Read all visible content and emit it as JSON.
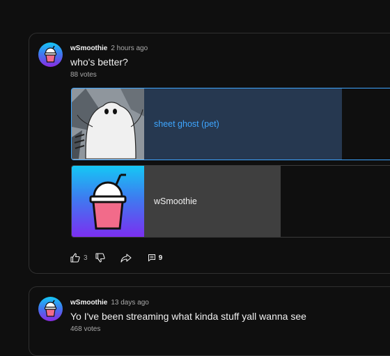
{
  "posts": [
    {
      "author": "wSmoothie",
      "time": "2 hours ago",
      "title": "who's better?",
      "votes": "88 votes",
      "options": [
        {
          "label": "sheet ghost (pet)",
          "percent": 80,
          "selected": true
        },
        {
          "label": "wSmoothie",
          "percent": 62,
          "selected": false
        }
      ],
      "likes": "3",
      "comments": "9"
    },
    {
      "author": "wSmoothie",
      "time": "13 days ago",
      "title": "Yo I've been streaming what kinda stuff yall wanna see",
      "votes": "468 votes"
    }
  ],
  "colors": {
    "accent": "#3ea6ff",
    "selected_bar": "#263850",
    "unselected_bar": "#3f3f3f",
    "background": "#0f0f0f"
  },
  "icons": [
    "avatar-smoothie-icon",
    "like-icon",
    "dislike-icon",
    "share-icon",
    "comment-icon"
  ]
}
